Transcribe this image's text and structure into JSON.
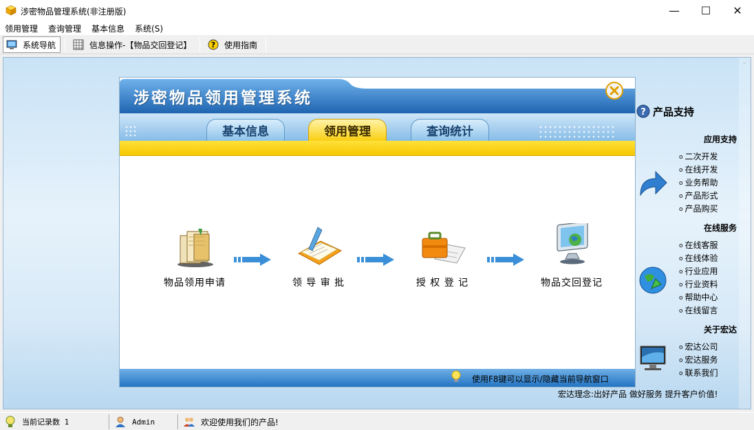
{
  "window": {
    "title": "涉密物品管理系统(非注册版)",
    "minimize_glyph": "—",
    "maximize_glyph": "☐",
    "close_glyph": "✕"
  },
  "menu": [
    "领用管理",
    "查询管理",
    "基本信息",
    "系统(S)"
  ],
  "toolbar": {
    "nav_label": "系统导航",
    "info_label": "信息操作-【物品交回登记】",
    "guide_label": "使用指南"
  },
  "nav": {
    "title": "涉密物品领用管理系统",
    "tabs": [
      "基本信息",
      "领用管理",
      "查询统计"
    ],
    "active_tab": "领用管理",
    "steps": [
      "物品领用申请",
      "领 导 审 批",
      "授 权 登 记",
      "物品交回登记"
    ],
    "footer_tip": "使用F8键可以显示/隐藏当前导航窗口"
  },
  "support": {
    "title": "产品支持",
    "sections": [
      {
        "heading": "应用支持",
        "links": [
          "二次开发",
          "在线开发",
          "业务帮助",
          "产品形式",
          "产品购买"
        ]
      },
      {
        "heading": "在线服务",
        "links": [
          "在线客服",
          "在线体验",
          "行业应用",
          "行业资料",
          "帮助中心",
          "在线留言"
        ]
      },
      {
        "heading": "关于宏达",
        "links": [
          "宏达公司",
          "宏达服务",
          "联系我们"
        ]
      }
    ],
    "motto": "宏达理念:出好产品  做好服务  提升客户价值!"
  },
  "statusbar": {
    "records": "当前记录数 1",
    "user": "Admin",
    "welcome": "欢迎使用我们的产品!"
  },
  "colors": {
    "header_blue": "#2f79c6",
    "tab_yellow": "#f9cf12",
    "footer_blue": "#1e6fc0"
  }
}
